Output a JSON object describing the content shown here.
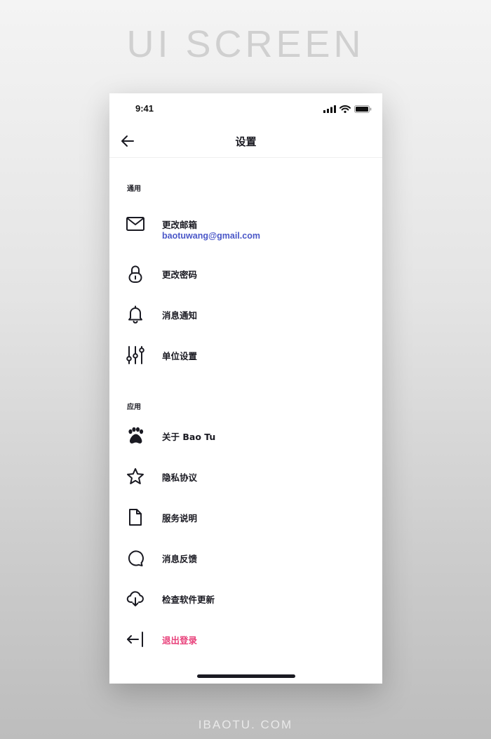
{
  "page": {
    "title": "UI SCREEN",
    "footer": "IBAOTU. COM"
  },
  "status_bar": {
    "time": "9:41",
    "icons": [
      "cellular-signal-icon",
      "wifi-icon",
      "battery-icon"
    ]
  },
  "nav": {
    "back_icon": "arrow-left-icon",
    "title": "设置"
  },
  "sections": {
    "general": {
      "header": "通用"
    },
    "app": {
      "header": "应用"
    }
  },
  "items": {
    "change_email": {
      "label": "更改邮箱",
      "value": "baotuwang@gmail.com",
      "icon": "mail-icon"
    },
    "change_password": {
      "label": "更改密码",
      "icon": "lock-icon"
    },
    "notifications": {
      "label": "消息通知",
      "icon": "bell-icon"
    },
    "units": {
      "label": "单位设置",
      "icon": "sliders-icon"
    },
    "about": {
      "label": "关于 Bao Tu",
      "icon": "paw-icon"
    },
    "privacy": {
      "label": "隐私协议",
      "icon": "star-icon"
    },
    "terms": {
      "label": "服务说明",
      "icon": "file-icon"
    },
    "feedback": {
      "label": "消息反馈",
      "icon": "chat-bubble-icon"
    },
    "update": {
      "label": "检查软件更新",
      "icon": "cloud-download-icon"
    },
    "logout": {
      "label": "退出登录",
      "icon": "logout-icon"
    }
  },
  "colors": {
    "accent_link": "#4a57c8",
    "danger": "#e8407a",
    "text": "#1a1a22"
  }
}
